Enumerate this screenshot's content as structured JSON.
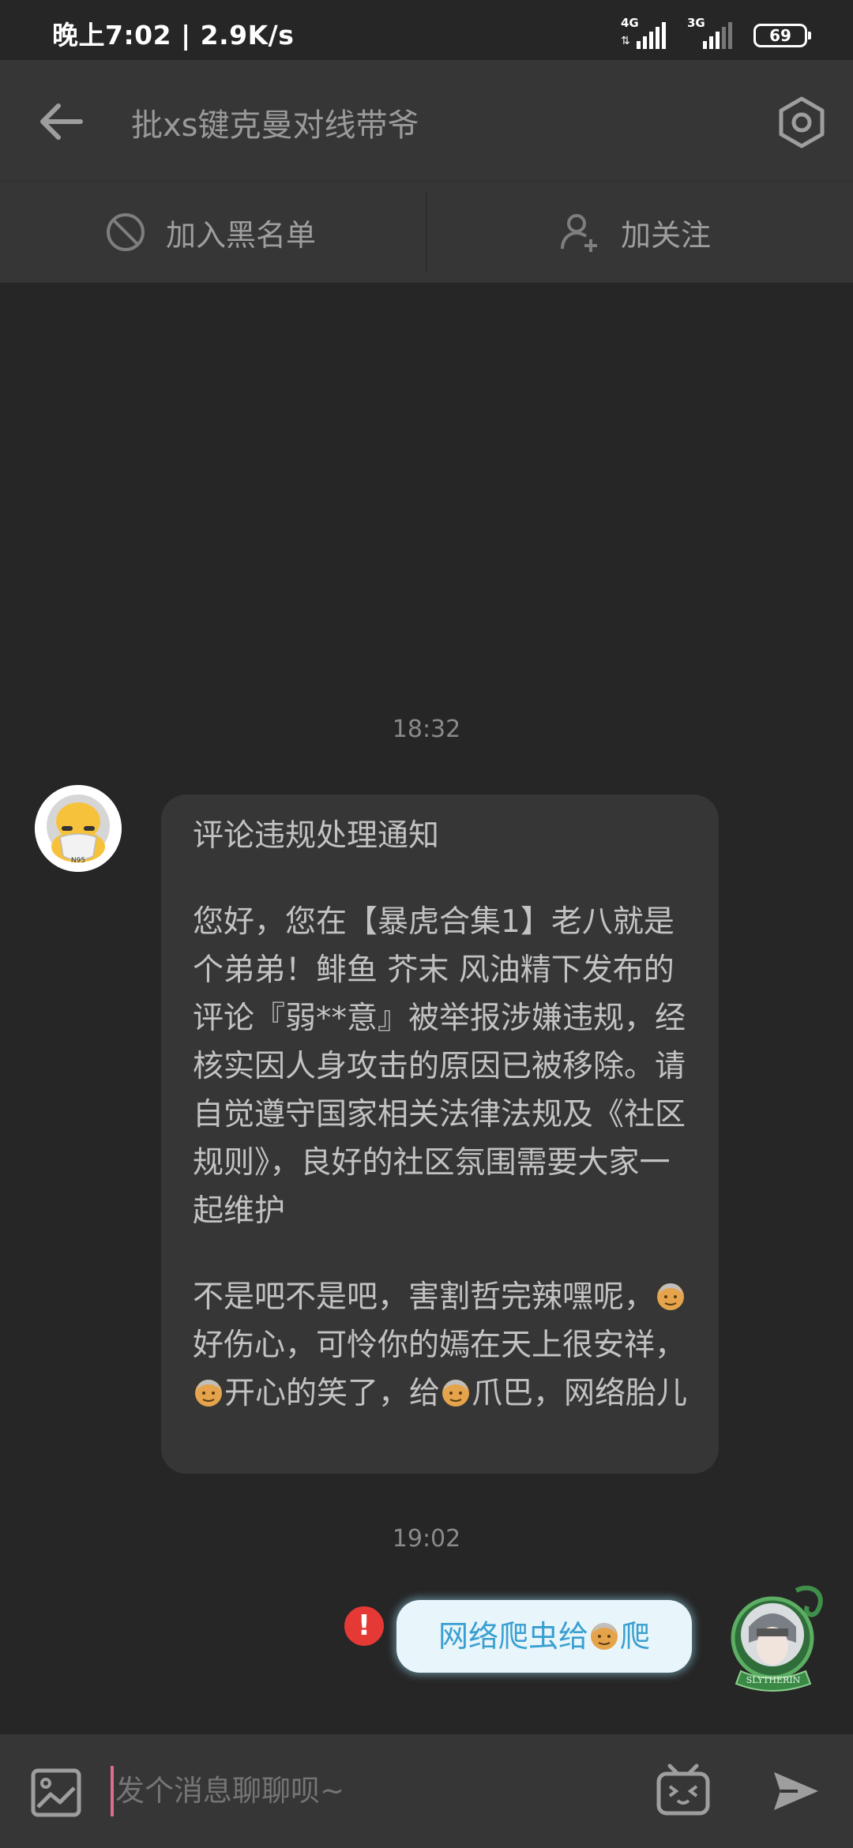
{
  "status_bar": {
    "time": "晚上7:02 | 2.9K/s",
    "network_1": "4G",
    "network_2": "3G",
    "battery": "69"
  },
  "header": {
    "title": "批xs键克曼对线带爷"
  },
  "actions": {
    "blacklist": "加入黑名单",
    "follow": "加关注"
  },
  "messages": {
    "timestamp_1": "18:32",
    "notice_title": "评论违规处理通知",
    "notice_body": "您好，您在【暴虎合集1】老八就是个弟弟！鲱鱼 芥末 风油精下发布的评论『弱**意』被举报涉嫌违规，经核实因人身攻击的原因已被移除。请自觉遵守国家相关法律法规及《社区规则》，良好的社区氛围需要大家一起维护",
    "reply_part_1": "不是吧不是吧，害割哲完辣嘿呢，",
    "reply_part_2": "好伤心，可怜你的嫣在天上很安祥，",
    "reply_part_3": "开心的笑了，给",
    "reply_part_4": "爪巴，网络胎儿",
    "timestamp_2": "19:02",
    "sent_part_1": "网络爬虫给",
    "sent_part_2": "爬",
    "avatar_left_label": "N95",
    "avatar_right_label": "SLYTHERIN"
  },
  "input": {
    "placeholder": "发个消息聊聊呗~"
  },
  "colors": {
    "background": "#262626",
    "bar": "#363636",
    "accent_pink": "#e06c8c",
    "sent_text": "#3a9fd0",
    "error": "#e53935"
  }
}
